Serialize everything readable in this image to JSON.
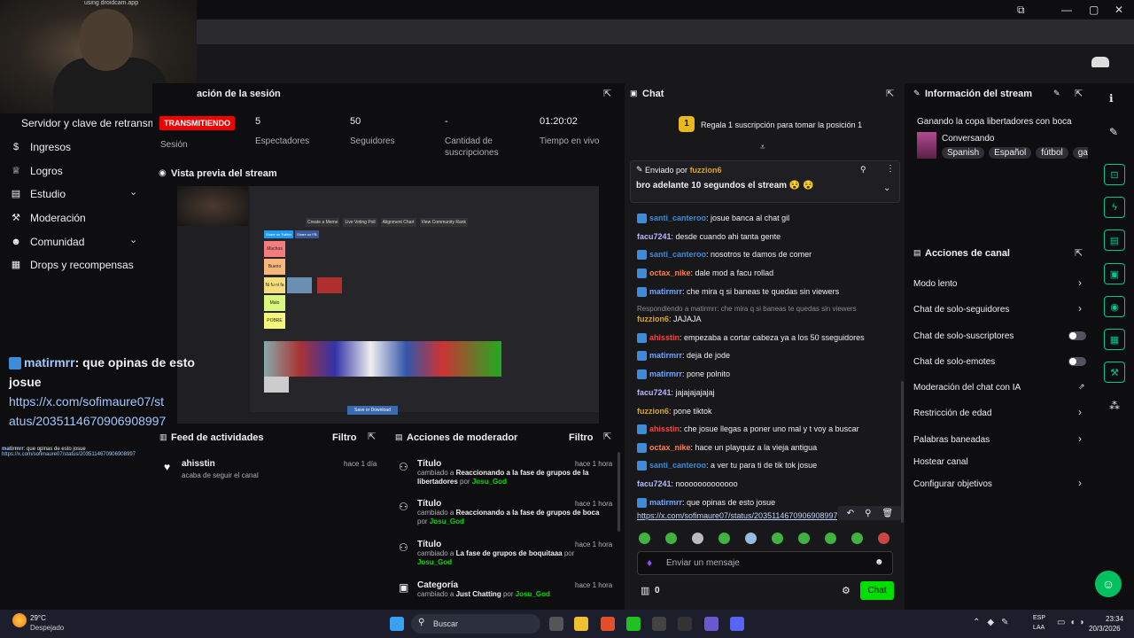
{
  "webcam": {
    "caption": "using droidcam.app"
  },
  "window": {
    "controls": [
      "⧉",
      "—",
      "▢",
      "✕"
    ]
  },
  "sidebar": {
    "truncated_item": "Servidor y clave de retransm",
    "items": [
      {
        "label": "Ingresos",
        "icon": "dollar-icon"
      },
      {
        "label": "Logros",
        "icon": "trophy-icon"
      },
      {
        "label": "Estudio",
        "icon": "film-icon",
        "expand": "⌄"
      },
      {
        "label": "Moderación",
        "icon": "wrench-icon"
      },
      {
        "label": "Comunidad",
        "icon": "people-icon",
        "expand": "⌄"
      },
      {
        "label": "Drops y recompensas",
        "icon": "gift-icon"
      }
    ]
  },
  "session": {
    "title": "ación de la sesión",
    "live_badge": "TRANSMITIENDO",
    "session_label": "Sesión",
    "stats": [
      {
        "value": "5",
        "label": "Espectadores"
      },
      {
        "value": "50",
        "label": "Seguidores"
      },
      {
        "value": "-",
        "label": "Cantidad de suscripciones"
      },
      {
        "value": "01:20:02",
        "label": "Tiempo en vivo"
      }
    ]
  },
  "preview": {
    "title": "Vista previa del stream",
    "inner_buttons": [
      "Create a Meme",
      "Live Voting Poll",
      "Alignment Chart",
      "View Community Rank"
    ],
    "share_buttons": [
      "Share on Twitter",
      "Share on FB"
    ],
    "tiers": [
      "Muchos",
      "Bueno",
      "Ni fu ni fa",
      "Malo",
      "POBRE"
    ],
    "save_button": "Save or Download"
  },
  "overlay": {
    "user": "matirmrr",
    "message": ": que opinas de esto josue",
    "link": "https://x.com/sofimaure07/status/2035114670906908997",
    "small_user": "matirmrr",
    "small_message": ": que opinas de esto josue",
    "small_link": "https://x.com/sofimaure07/status/2035114670906908997"
  },
  "activity": {
    "title": "Feed de actividades",
    "filter": "Filtro",
    "items": [
      {
        "user": "ahisstin",
        "text": "acaba de seguir el canal",
        "time": "hace 1 día"
      }
    ]
  },
  "mod_actions": {
    "title": "Acciones de moderador",
    "filter": "Filtro",
    "items": [
      {
        "title": "Título",
        "time": "hace 1 hora",
        "pre": "cambiado a",
        "value": "Reaccionando a la fase de grupos de la libertadores",
        "by": "por",
        "user": "Josu_God"
      },
      {
        "title": "Título",
        "time": "hace 1 hora",
        "pre": "cambiado a",
        "value": "Reaccionando a la fase de grupos de boca",
        "by": "por",
        "user": "Josu_God"
      },
      {
        "title": "Título",
        "time": "hace 1 hora",
        "pre": "cambiado a",
        "value": "La fase de grupos de boquitaaa",
        "by": "por",
        "user": "Josu_God"
      },
      {
        "title": "Categoría",
        "time": "hace 1 hora",
        "pre": "cambiado a",
        "value": "Just Chatting",
        "by": "por",
        "user": "Josu_God"
      }
    ]
  },
  "chat": {
    "title": "Chat",
    "gift_rank": "1",
    "gift_text": "Regala 1 suscripción para tomar la posición 1",
    "pinned_label": "Enviado por",
    "pinned_user": "fuzzion6",
    "pinned_message": "bro adelante 10 segundos el stream 😵 😵",
    "reply_context": "Respondiendo a matirmrr: che mira q si baneas te quedas sin viewers",
    "messages": [
      {
        "user": "santi_canteroo",
        "color": "#3d8bd9",
        "text": ": josue banca al chat gil",
        "badge": true
      },
      {
        "user": "facu7241",
        "color": "#b8b8ff",
        "text": ": desde cuando ahi tanta gente",
        "badge": false
      },
      {
        "user": "santi_canteroo",
        "color": "#3d8bd9",
        "text": ": nosotros te damos de comer",
        "badge": true
      },
      {
        "user": "octax_nike",
        "color": "#ff7f50",
        "text": ": dale mod a facu rollad",
        "badge": true
      },
      {
        "user": "matirmrr",
        "color": "#6fa8ff",
        "text": ": che mira q si baneas te quedas sin viewers",
        "badge": true
      },
      {
        "user": "fuzzion6",
        "color": "#daa520",
        "text": ": JAJAJA",
        "badge": false
      },
      {
        "user": "ahisstin",
        "color": "#ff4040",
        "text": ": empezaba a cortar cabeza ya a los 50 sseguidores",
        "badge": true
      },
      {
        "user": "matirmrr",
        "color": "#6fa8ff",
        "text": ": deja de jode",
        "badge": true
      },
      {
        "user": "matirmrr",
        "color": "#6fa8ff",
        "text": ": pone polnito",
        "badge": true
      },
      {
        "user": "facu7241",
        "color": "#b8b8ff",
        "text": ": jajajajajajaj",
        "badge": false
      },
      {
        "user": "fuzzion6",
        "color": "#daa520",
        "text": ": pone tiktok",
        "badge": false
      },
      {
        "user": "ahisstin",
        "color": "#ff4040",
        "text": ": che josue llegas a poner uno mal y t voy a buscar",
        "badge": true
      },
      {
        "user": "octax_nike",
        "color": "#ff7f50",
        "text": ": hace un playquiz a la vieja antigua",
        "badge": true
      },
      {
        "user": "santi_canteroo",
        "color": "#3d8bd9",
        "text": ": a ver tu para ti de tik tok josue",
        "badge": true
      },
      {
        "user": "facu7241",
        "color": "#b8b8ff",
        "text": ": nooooooooooooo",
        "badge": false
      },
      {
        "user": "matirmrr",
        "color": "#6fa8ff",
        "text": ": que opinas de esto josue",
        "badge": true
      }
    ],
    "last_link": "https://x.com/sofimaure07/status/2035114670906908997",
    "input_placeholder": "Enviar un mensaje",
    "points": "0",
    "send_label": "Chat"
  },
  "stream_info": {
    "title": "Información del stream",
    "stream_title": "Ganando la copa libertadores con boca",
    "category": "Conversando",
    "tags": [
      "Spanish",
      "Español",
      "fútbol",
      "ga"
    ]
  },
  "channel_actions": {
    "title": "Acciones de canal",
    "items": [
      {
        "label": "Modo lento",
        "control": "chevron"
      },
      {
        "label": "Chat de solo-seguidores",
        "control": "chevron"
      },
      {
        "label": "Chat de solo-suscriptores",
        "control": "toggle"
      },
      {
        "label": "Chat de solo-emotes",
        "control": "toggle"
      },
      {
        "label": "Moderación del chat con IA",
        "control": "external"
      },
      {
        "label": "Restricción de edad",
        "control": "chevron"
      },
      {
        "label": "Palabras baneadas",
        "control": "chevron"
      },
      {
        "label": "Hostear canal",
        "control": "none"
      },
      {
        "label": "Configurar objetivos",
        "control": "chevron"
      }
    ]
  },
  "taskbar": {
    "temp": "29°C",
    "weather": "Despejado",
    "search_placeholder": "Buscar",
    "lang_top": "ESP",
    "lang_bottom": "LAA",
    "time": "23:34",
    "date": "20/3/2026"
  },
  "colors": {
    "accent": "#00e000",
    "live": "#eb0400",
    "link": "#a0c8ff",
    "rail": "#00c890"
  }
}
